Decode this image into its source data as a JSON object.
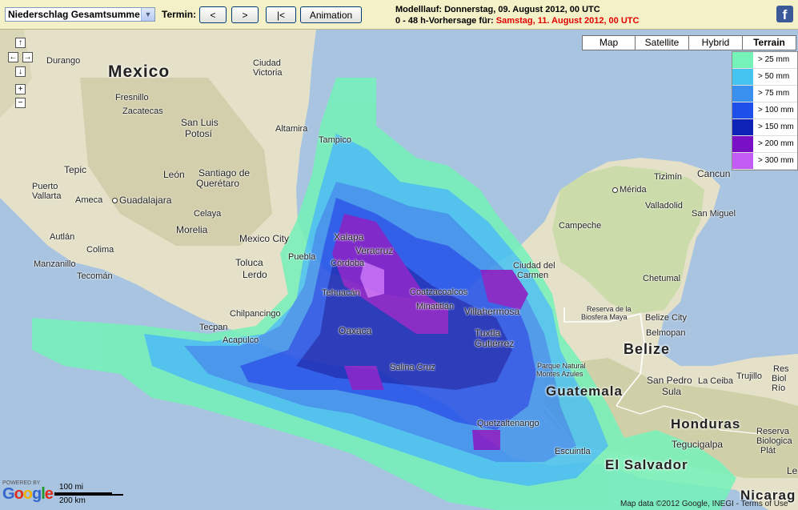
{
  "toolbar": {
    "product_select": "Niederschlag Gesamtsumme",
    "termin_label": "Termin:",
    "prev_label": "<",
    "next_label": ">",
    "first_label": "|<",
    "animation_label": "Animation",
    "model_run": "Modelllauf: Donnerstag, 09. August 2012, 00 UTC",
    "forecast_prefix": "0 - 48 h-Vorhersage für:",
    "forecast_date": "Samstag, 11. August 2012, 00 UTC",
    "facebook_glyph": "f"
  },
  "map_types": {
    "map": "Map",
    "satellite": "Satellite",
    "hybrid": "Hybrid",
    "terrain": "Terrain",
    "selected": "Terrain"
  },
  "legend": [
    {
      "label": "> 25 mm",
      "color": "#74f2b8"
    },
    {
      "label": "> 50 mm",
      "color": "#45c3f0"
    },
    {
      "label": "> 75 mm",
      "color": "#3a90ef"
    },
    {
      "label": "> 100 mm",
      "color": "#1f4fea"
    },
    {
      "label": "> 150 mm",
      "color": "#0f22b8"
    },
    {
      "label": "> 200 mm",
      "color": "#7a10c6"
    },
    {
      "label": "> 300 mm",
      "color": "#c25cf4"
    }
  ],
  "nav": {
    "up": "↑",
    "left": "←",
    "right": "→",
    "down": "↓",
    "zoom_in": "+",
    "zoom_out": "−"
  },
  "countries": {
    "mexico": "Mexico",
    "belize": "Belize",
    "guatemala": "Guatemala",
    "honduras": "Honduras",
    "el_salvador": "El Salvador",
    "nicaragua": "Nicarag"
  },
  "cities": {
    "durango": "Durango",
    "ciudad": "Ciudad",
    "victoria": "Victoria",
    "fresnillo": "Fresnillo",
    "zacatecas": "Zacatecas",
    "san_luis": "San Luis",
    "potosi": "Potosí",
    "altamira": "Altamira",
    "tampico": "Tampico",
    "tepic": "Tepic",
    "leon": "León",
    "santiago": "Santiago de",
    "queretaro": "Querétaro",
    "puerto": "Puerto",
    "vallarta": "Vallarta",
    "ameca": "Ameca",
    "guadalajara": "Guadalajara",
    "celaya": "Celaya",
    "morelia": "Morelia",
    "autlan": "Autlán",
    "mexico_city": "Mexico City",
    "xalapa": "Xalapa",
    "veracruz": "Veracruz",
    "colima": "Colima",
    "manzanillo": "Manzanillo",
    "toluca": "Toluca",
    "lerdo": "Lerdo",
    "puebla": "Puebla",
    "cordoba": "Córdoba",
    "tecoman": "Tecomán",
    "tehuacan": "Tehuacán",
    "coatzacoalcos": "Coatzacoalcos",
    "minatitlan": "Minatitlán",
    "villahermosa": "Villahermosa",
    "chilpancingo": "Chilpancingo",
    "tecpan": "Tecpan",
    "acapulco": "Acapulco",
    "oaxaca": "Oaxaca",
    "tuxtla": "Tuxtla",
    "gutierrez": "Gutiérrez",
    "salina_cruz": "Salina Cruz",
    "merida": "Mérida",
    "cancun": "Cancun",
    "tizimin": "Tizimín",
    "valladolid": "Valladolid",
    "san_miguel": "San Miguel",
    "campeche": "Campeche",
    "ciudad_del": "Ciudad del",
    "carmen": "Carmen",
    "chetumal": "Chetumal",
    "reserva": "Reserva de la",
    "biosfera": "Biosfera Maya",
    "belize_city": "Belize City",
    "belmopan": "Belmopan",
    "parque": "Parque Natural",
    "montes": "Montes Azules",
    "quetzaltenango": "Quetzaltenango",
    "escuintla": "Escuintla",
    "san_pedro": "San Pedro",
    "sula": "Sula",
    "la_ceiba": "La Ceiba",
    "trujillo": "Trujillo",
    "res_right": "Res",
    "biol_right": "Biol",
    "rio_right": "Río",
    "tegucigalpa": "Tegucigalpa",
    "reserva2": "Reserva",
    "biologica": "Biologica",
    "plat": "Plát",
    "leon_tag": "Le"
  },
  "footer": {
    "powered_by": "POWERED BY",
    "google": "Google",
    "scale_mi": "100 mi",
    "scale_km": "200 km",
    "attribution": "Map data ©2012 Google, INEGI - Terms of Use"
  }
}
